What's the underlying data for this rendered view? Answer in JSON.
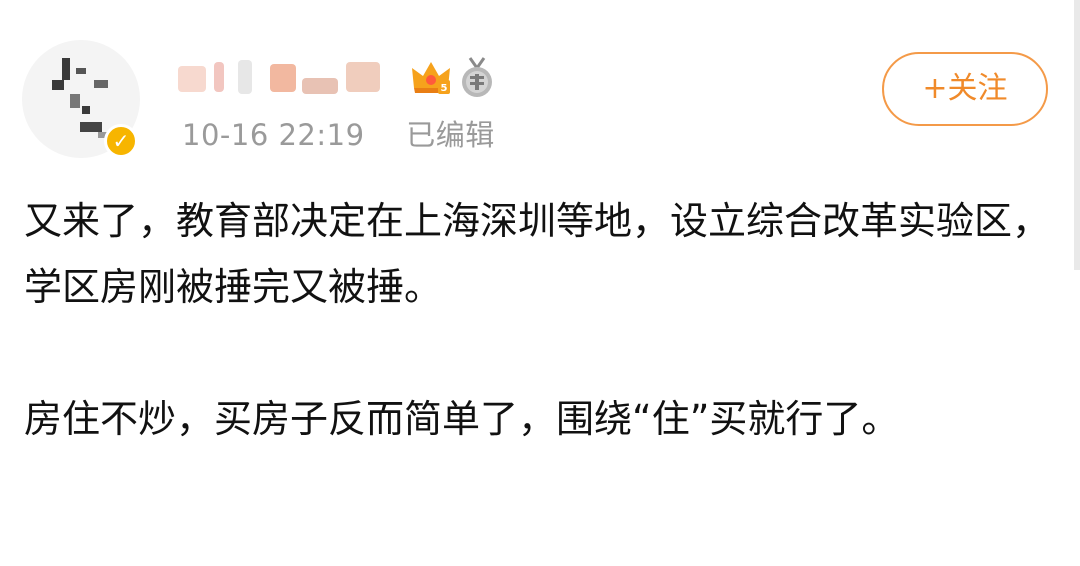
{
  "post": {
    "author": {
      "name": "",
      "verified": true
    },
    "timestamp": "10-16 22:19",
    "edited_label": "已编辑",
    "follow_label": "+关注",
    "paragraphs": [
      "又来了，教育部决定在上海深圳等地，设立综合改革实验区，学区房刚被捶完又被捶。",
      "房住不炒，买房子反而简单了，围绕“住”买就行了。"
    ]
  },
  "colors": {
    "accent_orange": "#f08a2a",
    "verified_gold": "#f7b500",
    "meta_gray": "#9a9a9a"
  },
  "icons": {
    "crown": "crown-vip-icon",
    "medal": "medal-badge-icon",
    "verified": "verified-v-icon"
  }
}
